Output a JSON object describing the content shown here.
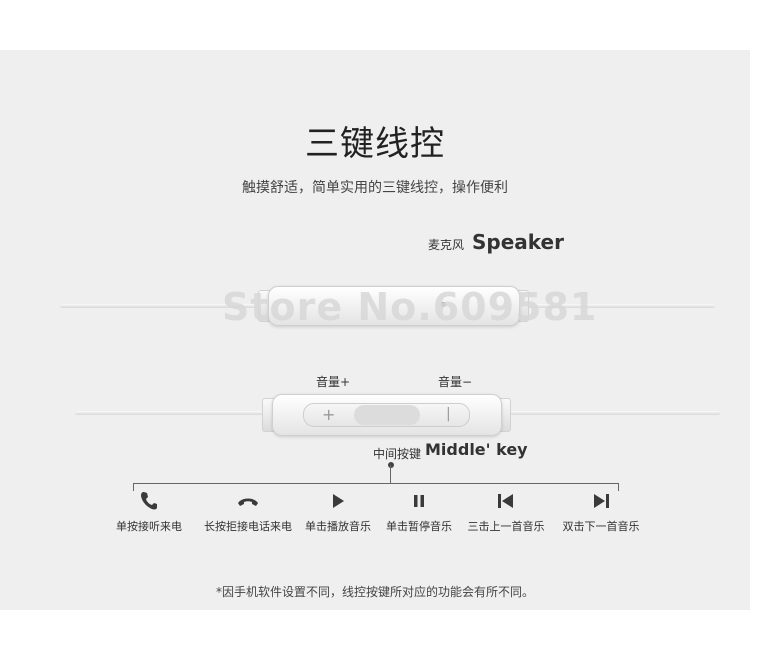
{
  "header": {
    "title": "三键线控",
    "subtitle": "触摸舒适，简单实用的三键线控，操作便利"
  },
  "speaker": {
    "label_cn": "麦克风",
    "label_en": "Speaker"
  },
  "watermark": "Store No.609581",
  "volume": {
    "plus_label": "音量+",
    "minus_label": "音量−",
    "plus_sign": "+",
    "minus_sign": "|"
  },
  "middle_key": {
    "label_cn": "中间按键",
    "label_en": "Middle' key"
  },
  "functions": [
    {
      "icon": "phone-icon",
      "label": "单按接听来电"
    },
    {
      "icon": "hang-up-icon",
      "label": "长按拒接电话来电"
    },
    {
      "icon": "play-icon",
      "label": "单击播放音乐"
    },
    {
      "icon": "pause-icon",
      "label": "单击暂停音乐"
    },
    {
      "icon": "previous-track-icon",
      "label": "三击上一首音乐"
    },
    {
      "icon": "next-track-icon",
      "label": "双击下一首音乐"
    }
  ],
  "footnote": "*因手机软件设置不同，线控按键所对应的功能会有所不同。",
  "colors": {
    "panel_background": "#efefef",
    "text": "#333333",
    "icon": "#3a3a3a"
  }
}
